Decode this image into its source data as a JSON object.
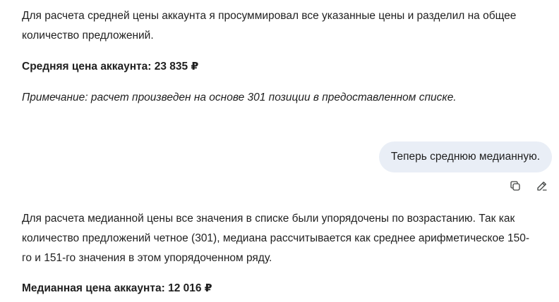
{
  "assistant_message_1": {
    "line1": "Для расчета средней цены аккаунта я просуммировал все указанные цены и разделил на общее",
    "line2": "количество предложений.",
    "result_label": "Средняя цена аккаунта: 23 835 ₽",
    "note": "Примечание: расчет произведен на основе 301 позиции в предоставленном списке."
  },
  "user_message": {
    "text": "Теперь среднюю медианную."
  },
  "user_actions": {
    "copy_icon": "copy-icon",
    "edit_icon": "pencil-icon"
  },
  "assistant_message_2": {
    "line1": "Для расчета медианной цены все значения в списке были упорядочены по возрастанию. Так как",
    "line2": "количество предложений четное (301), медиана рассчитывается как среднее арифметическое 150-",
    "line3": "го и 151-го значения в этом упорядоченном ряду.",
    "result_label": "Медианная цена аккаунта: 12 016 ₽"
  },
  "colors": {
    "bubble_bg": "#e9eef6",
    "text": "#1f1f1f",
    "icon": "#444746"
  }
}
